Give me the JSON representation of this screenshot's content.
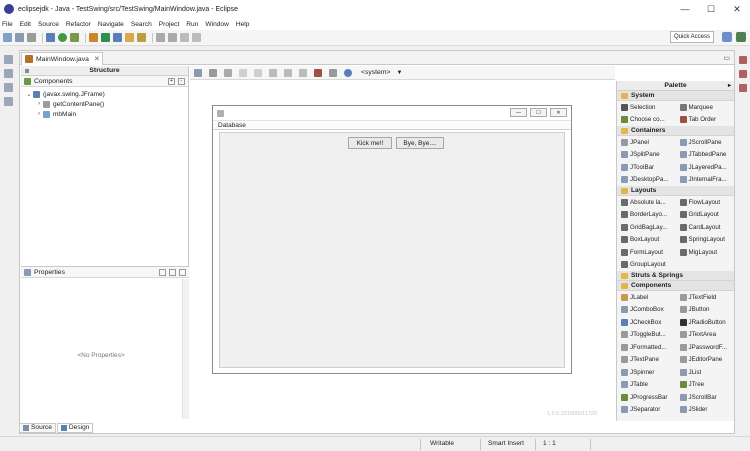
{
  "window": {
    "title": "eclipsejdk - Java - TestSwing/src/TestSwing/MainWindow.java - Eclipse",
    "minimize_glyph": "—",
    "maximize_glyph": "☐",
    "close_glyph": "✕"
  },
  "menu": [
    "File",
    "Edit",
    "Source",
    "Refactor",
    "Navigate",
    "Search",
    "Project",
    "Run",
    "Window",
    "Help"
  ],
  "toolbar": {
    "quick_access": "Quick Access"
  },
  "editor": {
    "tab_label": "MainWindow.java",
    "tab_close": "✕",
    "minimize_glyph": "▭"
  },
  "structure": {
    "title": "Structure",
    "components_label": "Components",
    "tree": [
      {
        "label": "(javax.swing.JFrame)",
        "twisty": "⌄",
        "indent": 0,
        "color": "#5a7fb8"
      },
      {
        "label": "getContentPane()",
        "twisty": "›",
        "indent": 1,
        "color": "#9c9c9c"
      },
      {
        "label": "mbMain",
        "twisty": "›",
        "indent": 1,
        "color": "#7b9fcf"
      }
    ]
  },
  "properties": {
    "title": "Properties",
    "empty_text": "<No Properties>"
  },
  "design_toolbar": {
    "system_combo": "<system>"
  },
  "frame": {
    "menu_label": "Database",
    "button1": "Kick me!!",
    "button2": "Bye, Bye....",
    "version": "1.9.0.201806011720"
  },
  "palette": {
    "title": "Palette",
    "collapse_glyph": "▸",
    "categories": [
      {
        "name": "System",
        "items": [
          {
            "label": "Selection",
            "icon": "arrow-icon",
            "color": "#555555"
          },
          {
            "label": "Marquee",
            "icon": "marquee-icon",
            "color": "#777777"
          },
          {
            "label": "Choose co...",
            "icon": "choose-icon",
            "color": "#6c8c3c"
          },
          {
            "label": "Tab Order",
            "icon": "taborder-icon",
            "color": "#a05040"
          }
        ]
      },
      {
        "name": "Containers",
        "items": [
          {
            "label": "JPanel",
            "icon": "panel-icon",
            "color": "#9a9a9a"
          },
          {
            "label": "JScrollPane",
            "icon": "scrollpane-icon",
            "color": "#8a9ab0"
          },
          {
            "label": "JSplitPane",
            "icon": "splitpane-icon",
            "color": "#8a9ab0"
          },
          {
            "label": "JTabbedPane",
            "icon": "tabbedpane-icon",
            "color": "#8a9ab0"
          },
          {
            "label": "JToolBar",
            "icon": "toolbar-icon",
            "color": "#8a9ab0"
          },
          {
            "label": "JLayeredPa...",
            "icon": "layered-icon",
            "color": "#8a9ab0"
          },
          {
            "label": "JDesktopPa...",
            "icon": "desktop-icon",
            "color": "#8a9ab0"
          },
          {
            "label": "JInternalFra...",
            "icon": "internalframe-icon",
            "color": "#8a9ab0"
          }
        ]
      },
      {
        "name": "Layouts",
        "items": [
          {
            "label": "Absolute la...",
            "icon": "absolute-icon",
            "color": "#6a6a6a"
          },
          {
            "label": "FlowLayout",
            "icon": "flow-icon",
            "color": "#6a6a6a"
          },
          {
            "label": "BorderLayo...",
            "icon": "border-icon",
            "color": "#6a6a6a"
          },
          {
            "label": "GridLayout",
            "icon": "grid-icon",
            "color": "#6a6a6a"
          },
          {
            "label": "GridBagLay...",
            "icon": "gridbag-icon",
            "color": "#6a6a6a"
          },
          {
            "label": "CardLayout",
            "icon": "card-icon",
            "color": "#6a6a6a"
          },
          {
            "label": "BoxLayout",
            "icon": "box-icon",
            "color": "#6a6a6a"
          },
          {
            "label": "SpringLayout",
            "icon": "spring-icon",
            "color": "#6a6a6a"
          },
          {
            "label": "FormLayout",
            "icon": "form-icon",
            "color": "#6a6a6a"
          },
          {
            "label": "MigLayout",
            "icon": "mig-icon",
            "color": "#6a6a6a"
          },
          {
            "label": "GroupLayout",
            "icon": "group-icon",
            "color": "#6a6a6a"
          }
        ]
      },
      {
        "name": "Struts & Springs",
        "items": []
      },
      {
        "name": "Components",
        "items": [
          {
            "label": "JLabel",
            "icon": "label-icon",
            "color": "#c89a4a"
          },
          {
            "label": "JTextField",
            "icon": "textfield-icon",
            "color": "#9a9a9a"
          },
          {
            "label": "JComboBox",
            "icon": "combobox-icon",
            "color": "#8a9ab0"
          },
          {
            "label": "JButton",
            "icon": "button-icon",
            "color": "#9a9a9a"
          },
          {
            "label": "JCheckBox",
            "icon": "checkbox-icon",
            "color": "#5a7fb8"
          },
          {
            "label": "JRadioButton",
            "icon": "radio-icon",
            "color": "#333333"
          },
          {
            "label": "JToggleBut...",
            "icon": "toggle-icon",
            "color": "#9a9a9a"
          },
          {
            "label": "JTextArea",
            "icon": "textarea-icon",
            "color": "#9a9a9a"
          },
          {
            "label": "JFormatted...",
            "icon": "formatted-icon",
            "color": "#9a9a9a"
          },
          {
            "label": "JPasswordF...",
            "icon": "password-icon",
            "color": "#9a9a9a"
          },
          {
            "label": "JTextPane",
            "icon": "textpane-icon",
            "color": "#9a9a9a"
          },
          {
            "label": "JEditorPane",
            "icon": "editorpane-icon",
            "color": "#9a9a9a"
          },
          {
            "label": "JSpinner",
            "icon": "spinner-icon",
            "color": "#8a9ab0"
          },
          {
            "label": "JList",
            "icon": "list-icon",
            "color": "#8a9ab0"
          },
          {
            "label": "JTable",
            "icon": "table-icon",
            "color": "#8a9ab0"
          },
          {
            "label": "JTree",
            "icon": "tree-icon",
            "color": "#6c8c3c"
          },
          {
            "label": "JProgressBar",
            "icon": "progress-icon",
            "color": "#6c8c3c"
          },
          {
            "label": "JScrollBar",
            "icon": "scrollbar-icon",
            "color": "#8a9ab0"
          },
          {
            "label": "JSeparator",
            "icon": "separator-icon",
            "color": "#8a9ab0"
          },
          {
            "label": "JSlider",
            "icon": "slider-icon",
            "color": "#8a9ab0"
          }
        ]
      }
    ]
  },
  "bottom_tabs": {
    "source": "Source",
    "design": "Design"
  },
  "status": {
    "writable": "Writable",
    "insert_mode": "Smart Insert",
    "position": "1 : 1"
  },
  "colors": {
    "accent": "#3b6fb6",
    "folder": "#e0b84a"
  }
}
